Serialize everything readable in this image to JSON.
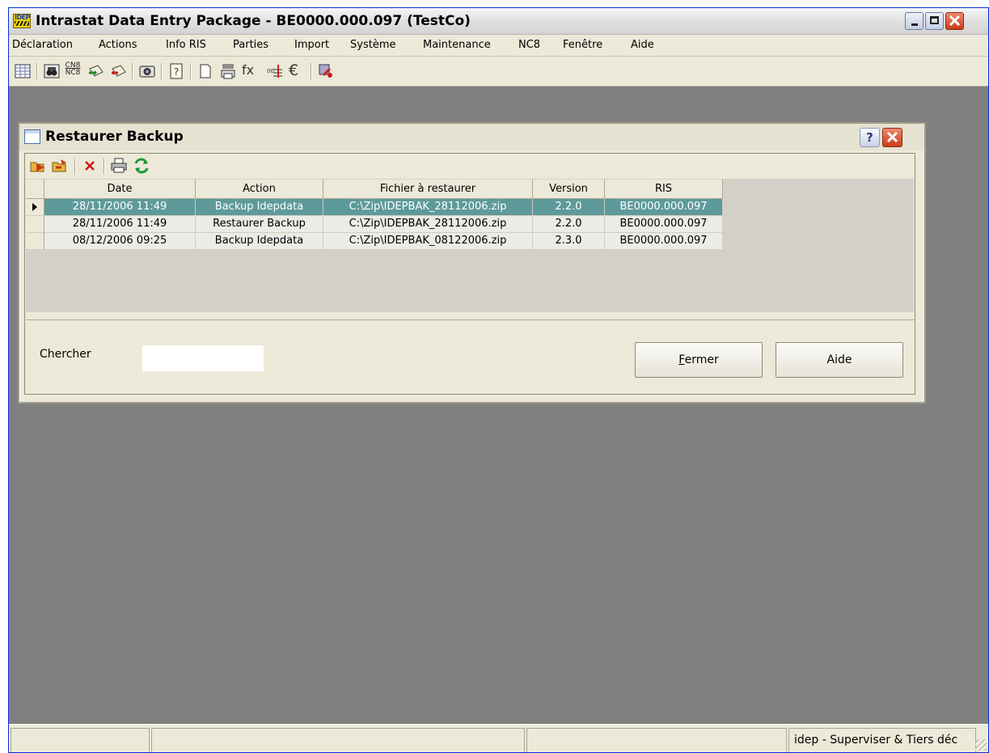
{
  "window": {
    "title": "Intrastat Data Entry Package - BE0000.000.097 (TestCo)",
    "logo_text": "IDEP"
  },
  "menu": [
    "Déclaration",
    "Actions",
    "Info RIS",
    "Parties",
    "Import",
    "Système",
    "Maintenance",
    "NC8",
    "Fenêtre",
    "Aide"
  ],
  "toolbar": {
    "icons": [
      "grid-icon",
      "binoculars-icon",
      "cn8-nc8-icon",
      "mail-send-icon",
      "mail-receive-icon",
      "camera-icon",
      "help-book-icon",
      "new-document-icon",
      "print-xml-icon",
      "function-icon",
      "number-format-icon",
      "euro-icon",
      "tools-icon"
    ],
    "cn8_label": "CN8",
    "nc8_label": "NC8",
    "fx_label": "fx",
    "euro_label": "€"
  },
  "dialog": {
    "title": "Restaurer Backup",
    "help_label": "?",
    "toolbar_icons": [
      "open-folder-icon",
      "restore-folder-icon",
      "delete-icon",
      "print-icon",
      "refresh-icon"
    ],
    "columns": [
      "Date",
      "Action",
      "Fichier à restaurer",
      "Version",
      "RIS"
    ],
    "rows": [
      {
        "date": "28/11/2006 11:49",
        "action": "Backup Idepdata",
        "file": "C:\\Zip\\IDEPBAK_28112006.zip",
        "version": "2.2.0",
        "ris": "BE0000.000.097"
      },
      {
        "date": "28/11/2006 11:49",
        "action": "Restaurer Backup",
        "file": "C:\\Zip\\IDEPBAK_28112006.zip",
        "version": "2.2.0",
        "ris": "BE0000.000.097"
      },
      {
        "date": "08/12/2006 09:25",
        "action": "Backup Idepdata",
        "file": "C:\\Zip\\IDEPBAK_08122006.zip",
        "version": "2.3.0",
        "ris": "BE0000.000.097"
      }
    ],
    "search_label": "Chercher",
    "search_value": "",
    "fermer_accel": "F",
    "fermer_rest": "ermer",
    "aide_label": "Aide"
  },
  "status": {
    "panel4": "idep - Superviser & Tiers déc"
  },
  "colors": {
    "selection": "#5e9a9a",
    "workspace": "#808080",
    "chrome": "#ece9d8"
  }
}
